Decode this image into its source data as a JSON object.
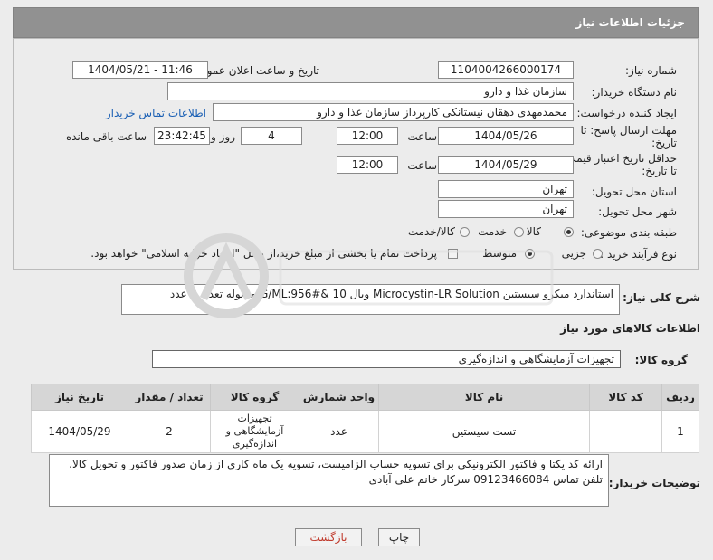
{
  "header": {
    "title": "جزئیات اطلاعات نیاز"
  },
  "fields": {
    "need_number_label": "شماره نیاز:",
    "need_number": "1104004266000174",
    "announce_label": "تاریخ و ساعت اعلان عمومی:",
    "announce_value": "1404/05/21 - 11:46",
    "buyer_org_label": "نام دستگاه خریدار:",
    "buyer_org": "سازمان غذا و دارو",
    "requester_label": "ایجاد کننده درخواست:",
    "requester": "محمدمهدی دهقان نیستانکی کارپرداز سازمان غذا و دارو",
    "contact_link": "اطلاعات تماس خریدار",
    "deadline_label_1": "مهلت ارسال پاسخ: تا",
    "deadline_label_2": "تاریخ:",
    "deadline_date": "1404/05/26",
    "time_label": "ساعت",
    "deadline_time": "12:00",
    "days_value": "4",
    "days_label": "روز و",
    "remaining_time": "23:42:45",
    "remaining_label": "ساعت باقی مانده",
    "price_label_1": "حداقل تاریخ اعتبار قیمت:",
    "price_label_2": "تا تاریخ:",
    "price_date": "1404/05/29",
    "price_time": "12:00",
    "province_label": "استان محل تحویل:",
    "province": "تهران",
    "city_label": "شهر محل تحویل:",
    "city": "تهران",
    "category_label": "طبقه بندی موضوعی:",
    "category_options": [
      "کالا",
      "خدمت",
      "کالا/خدمت"
    ],
    "process_label": "نوع فرآیند خرید :",
    "process_options": [
      "جزیی",
      "متوسط"
    ],
    "payment_note": "پرداخت تمام یا بخشی از مبلغ خرید،از محل \"اسناد خزانه اسلامی\" خواهد بود."
  },
  "summary": {
    "label": "شرح کلی نیاز:",
    "text": "استاندارد میکرو سیستین Microcystin-LR Solution   ویال G/ML:956#& 10  متانوله تعداد  2 عدد"
  },
  "goods": {
    "section_title": "اطلاعات کالاهای مورد نیاز",
    "group_label": "گروه کالا:",
    "group_value": "تجهیزات آزمایشگاهی و اندازه‌گیری"
  },
  "table": {
    "headers": [
      "ردیف",
      "کد کالا",
      "نام کالا",
      "واحد شمارش",
      "گروه کالا",
      "تعداد / مقدار",
      "تاریخ نیاز"
    ],
    "rows": [
      {
        "row": "1",
        "code": "--",
        "name": "تست سیستین",
        "unit": "عدد",
        "group": "تجهیزات آزمایشگاهی و اندازه‌گیری",
        "qty": "2",
        "date": "1404/05/29"
      }
    ]
  },
  "buyer_notes": {
    "label": "توضیحات خریدار:",
    "text": "ارائه کد یکتا و فاکتور الکترونیکی برای تسویه حساب الزامیست، تسویه یک ماه کاری از زمان صدور فاکتور و تحویل کالا، تلفن تماس 09123466084 سرکار خانم علی آبادی"
  },
  "buttons": {
    "print": "چاپ",
    "back": "بازگشت"
  },
  "colors": {
    "header_bg": "#919191",
    "link": "#1a5fb4",
    "back_text": "#c0392b"
  }
}
